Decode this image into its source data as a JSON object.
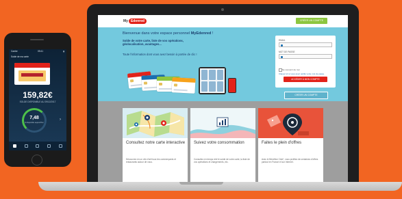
{
  "site": {
    "logo_prefix": "My",
    "logo_brand": "Edenred",
    "create_account_top": "CRÉER UN COMPTE"
  },
  "hero": {
    "welcome_prefix": "Bienvenue dans votre espace personnel ",
    "welcome_brand": "MyEdenred",
    "welcome_suffix": " !",
    "subtitle": "Solde de votre carte, liste de vos opérations, géolocalisation, avantages...",
    "description": "Toute l'information dont vous avez besoin à portée de clic !"
  },
  "login": {
    "email_label": "EMAIL",
    "password_label": "MOT DE PASSE",
    "remember_label": "Se souvenir de moi",
    "forgot_link": "Cliquez ici si vous avez oublié votre mot de passe.",
    "login_button": "ACCÉDER À MON COMPTE",
    "create_button": "CRÉER UN COMPTE"
  },
  "features": [
    {
      "title": "Consultez notre carte interactive",
      "description": "Découvrez en un clin d'œil tous les commerçants et restaurants autour de vous."
    },
    {
      "title": "Suivez votre consommation",
      "description": "Consultez en temps réel le solde de votre carte, la liste de vos opérations et chargements, etc."
    },
    {
      "title": "Faites le plein d'offres",
      "description": "Avec le Bénéfice Club*, vous profitez de centaines d'offres partout en France et sur Internet."
    }
  ],
  "phone": {
    "time": "09:41",
    "carrier": "Carrier",
    "account_label": "Solde de ma carte",
    "balance": "159,82€",
    "balance_label": "SOLDE DISPONIBLE AU 29/12/2017",
    "daily_amount": "7,48",
    "daily_label": "€ disponible aujourd'hui"
  },
  "colors": {
    "background": "#f26522",
    "brand_red": "#e2231a",
    "hero_blue": "#73c9de",
    "create_green": "#8dc63f"
  }
}
